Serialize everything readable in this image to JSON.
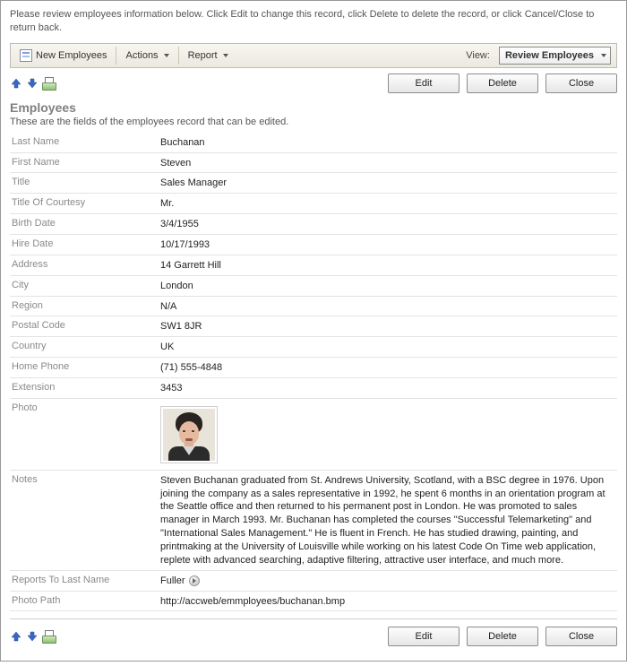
{
  "instructions": "Please review employees information below. Click Edit to change this record, click Delete to delete the record, or click Cancel/Close to return back.",
  "toolbar": {
    "new_label": "New Employees",
    "actions_label": "Actions",
    "report_label": "Report",
    "view_caption": "View:",
    "view_value": "Review Employees"
  },
  "buttons": {
    "edit": "Edit",
    "delete": "Delete",
    "close": "Close"
  },
  "section": {
    "title": "Employees",
    "subtitle": "These are the fields of the employees record that can be edited."
  },
  "fields": {
    "last_name": {
      "label": "Last Name",
      "value": "Buchanan"
    },
    "first_name": {
      "label": "First Name",
      "value": "Steven"
    },
    "title": {
      "label": "Title",
      "value": "Sales Manager"
    },
    "title_of_courtesy": {
      "label": "Title Of Courtesy",
      "value": "Mr."
    },
    "birth_date": {
      "label": "Birth Date",
      "value": "3/4/1955"
    },
    "hire_date": {
      "label": "Hire Date",
      "value": "10/17/1993"
    },
    "address": {
      "label": "Address",
      "value": "14 Garrett Hill"
    },
    "city": {
      "label": "City",
      "value": "London"
    },
    "region": {
      "label": "Region",
      "value": "N/A"
    },
    "postal_code": {
      "label": "Postal Code",
      "value": "SW1 8JR"
    },
    "country": {
      "label": "Country",
      "value": "UK"
    },
    "home_phone": {
      "label": "Home Phone",
      "value": "(71) 555-4848"
    },
    "extension": {
      "label": "Extension",
      "value": "3453"
    },
    "photo": {
      "label": "Photo"
    },
    "notes": {
      "label": "Notes",
      "value": "Steven Buchanan graduated from St. Andrews University, Scotland, with a BSC degree in 1976. Upon joining the company as a sales representative in 1992, he spent 6 months in an orientation program at the Seattle office and then returned to his permanent post in London. He was promoted to sales manager in March 1993. Mr. Buchanan has completed the courses \"Successful Telemarketing\" and \"International Sales Management.\" He is fluent in French. He has studied drawing, painting, and printmaking at the University of Louisville while working on his latest Code On Time web application, replete with advanced searching, adaptive filtering, attractive user interface, and much more."
    },
    "reports_to": {
      "label": "Reports To Last Name",
      "value": "Fuller"
    },
    "photo_path": {
      "label": "Photo Path",
      "value": "http://accweb/emmployees/buchanan.bmp"
    }
  }
}
